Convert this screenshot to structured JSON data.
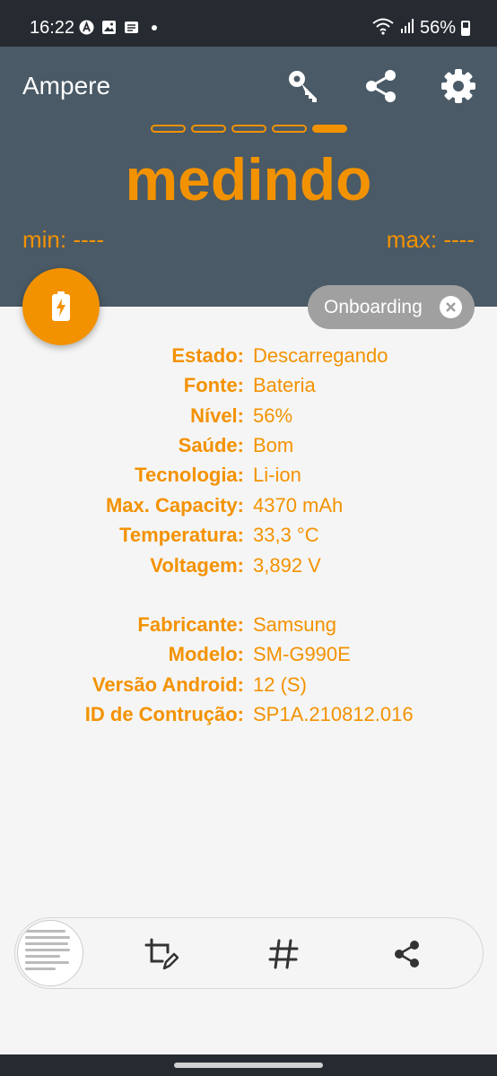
{
  "status_bar": {
    "time": "16:22",
    "battery_percent": "56%",
    "icons": [
      "a-circle-icon",
      "image-icon",
      "news-icon",
      "dot-icon",
      "wifi-icon",
      "signal-icon",
      "battery-icon"
    ]
  },
  "header": {
    "app_title": "Ampere",
    "actions": [
      "key-icon",
      "share-icon",
      "gear-icon"
    ],
    "progress_dashes_total": 5,
    "progress_dashes_active": 1,
    "big_value": "medindo",
    "min_label": "min: ----",
    "max_label": "max: ----"
  },
  "fab": {
    "icon": "battery-charging-icon"
  },
  "chip": {
    "label": "Onboarding",
    "close_icon": "close-icon"
  },
  "info": {
    "battery": [
      {
        "label": "Estado:",
        "value": "Descarregando"
      },
      {
        "label": "Fonte:",
        "value": "Bateria"
      },
      {
        "label": "Nível:",
        "value": "56%"
      },
      {
        "label": "Saúde:",
        "value": "Bom"
      },
      {
        "label": "Tecnologia:",
        "value": "Li-ion"
      },
      {
        "label": "Max. Capacity:",
        "value": "4370 mAh"
      },
      {
        "label": "Temperatura:",
        "value": "33,3 °C"
      },
      {
        "label": "Voltagem:",
        "value": "3,892 V"
      }
    ],
    "device": [
      {
        "label": "Fabricante:",
        "value": "Samsung"
      },
      {
        "label": "Modelo:",
        "value": "SM-G990E"
      },
      {
        "label": "Versão Android:",
        "value": "12 (S)"
      },
      {
        "label": "ID de Contrução:",
        "value": "SP1A.210812.016"
      }
    ]
  },
  "screenshot_toolbar": {
    "buttons": [
      "screenshot-thumbnail",
      "crop-edit-icon",
      "hashtag-icon",
      "share-icon"
    ]
  },
  "colors": {
    "accent": "#f39200",
    "header_bg": "#4a5a66",
    "status_bg": "#262b31",
    "body_bg": "#f5f5f5",
    "chip_bg": "#a0a0a0"
  }
}
